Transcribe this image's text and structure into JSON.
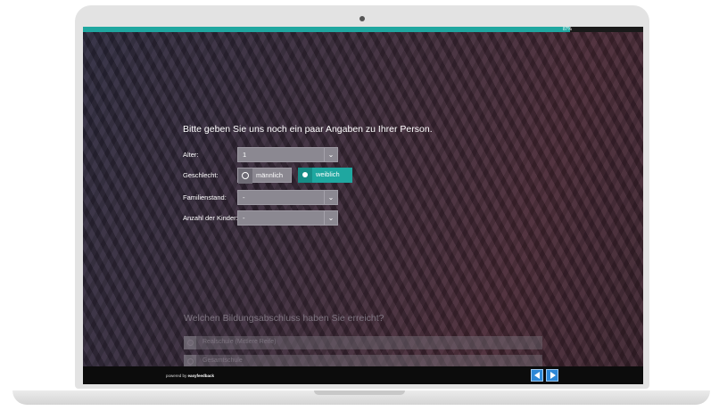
{
  "progress": {
    "label": "87%",
    "percent": 87,
    "color": "#1fa7a0"
  },
  "form": {
    "heading": "Bitte geben Sie uns noch ein paar Angaben zu Ihrer Person.",
    "age": {
      "label": "Alter:",
      "value": "1"
    },
    "gender": {
      "label": "Geschlecht:",
      "options": [
        "männlich",
        "weiblich"
      ],
      "selected": "weiblich"
    },
    "marital": {
      "label": "Familienstand:",
      "value": "-"
    },
    "children": {
      "label": "Anzahl der Kinder:",
      "value": "-"
    }
  },
  "next_question": {
    "title": "Welchen Bildungsabschluss haben Sie erreicht?",
    "options": [
      "Realschule (Mittlere Reife)",
      "Gesamtschule"
    ]
  },
  "footer": {
    "powered_prefix": "powered by",
    "brand": "easyfeedback"
  },
  "icons": {
    "prev": "arrow-left-icon",
    "next": "arrow-right-icon",
    "dropdown": "chevron-down-icon"
  }
}
